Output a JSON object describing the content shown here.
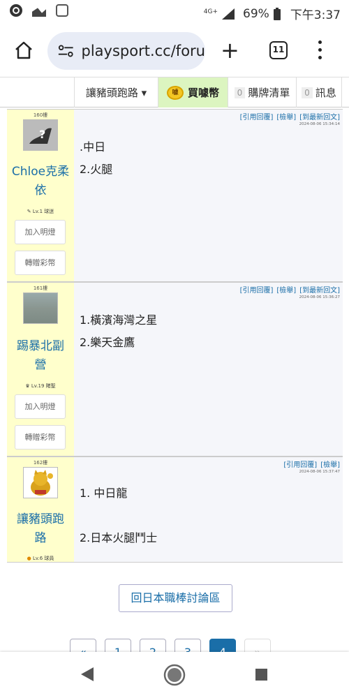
{
  "status": {
    "battery_pct": "69%",
    "time": "下午3:37",
    "network": "4G+"
  },
  "browser": {
    "url": "playsport.cc/foru",
    "tab_count": "11"
  },
  "sitenav": {
    "user": "讓豬頭跑路 ▾",
    "coin_label": "買噱幣",
    "coin_icon_text": "噱",
    "cart_count": "0",
    "cart_label": "購牌清單",
    "msg_count": "0",
    "msg_label": "訊息"
  },
  "post_actions": {
    "quote": "[引用回覆]",
    "report": "[檢舉]",
    "latest": "[到最新回文]"
  },
  "posts": [
    {
      "floor": "160樓",
      "user": [
        "Chloe克柔",
        "依"
      ],
      "level": "Lv.1 球迷",
      "time": "2024-08-06 15:34:14",
      "lines": [
        ".中日",
        "2.火腿"
      ],
      "btn_light": "加入明燈",
      "btn_gift": "轉贈彩幣"
    },
    {
      "floor": "161樓",
      "user": [
        "踢暴北副",
        "營"
      ],
      "level": "Lv.19 賭聖",
      "time": "2024-08-06 15:36:27",
      "lines": [
        "1.橫濱海灣之星",
        "2.樂天金鷹"
      ],
      "btn_light": "加入明燈",
      "btn_gift": "轉贈彩幣"
    },
    {
      "floor": "162樓",
      "user": [
        "讓豬頭跑",
        "路"
      ],
      "level": "Lv.6 球員",
      "time": "2024-08-06 15:37:47",
      "lines": [
        "1. 中日龍",
        "2.日本火腿鬥士"
      ]
    }
  ],
  "back_link": "回日本職棒討論區",
  "pagination": [
    "«",
    "1",
    "2",
    "3",
    "4",
    "»"
  ],
  "pagination_current": "4"
}
